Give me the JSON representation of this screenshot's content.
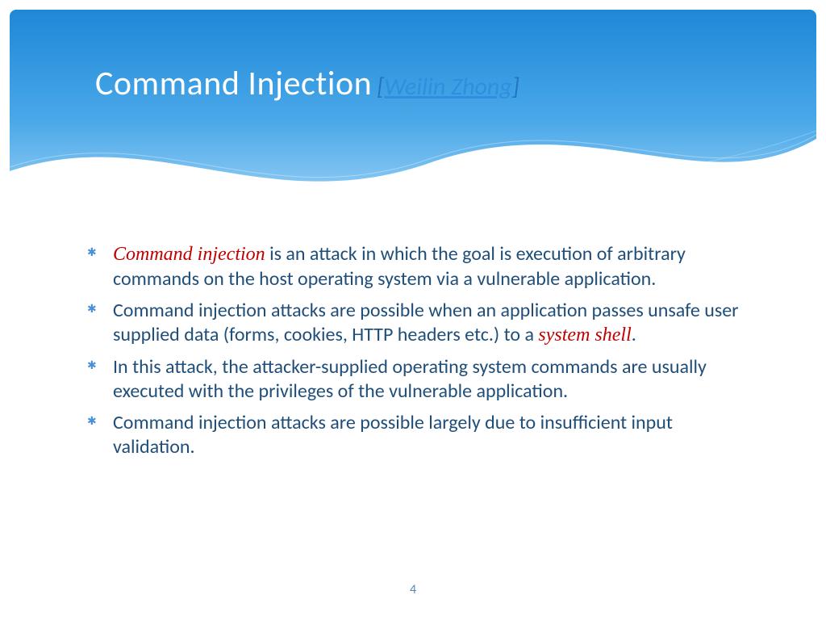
{
  "title": {
    "main": "Command Injection",
    "bracket_open": "[",
    "author_link": "Weilin Zhong",
    "bracket_close": "]"
  },
  "bullets": [
    {
      "lead_em": "Command injection",
      "rest": " is an attack in which the goal is execution of arbitrary commands on the host operating system via a vulnerable application."
    },
    {
      "pre": "Command injection attacks are possible when an application passes unsafe user supplied data (forms, cookies, HTTP headers etc.) to a ",
      "em": "system shell",
      "post": "."
    },
    {
      "text": "In this attack, the attacker-supplied operating system commands are usually executed with the privileges of the vulnerable application."
    },
    {
      "text": "Command injection attacks are possible largely due to insufficient input validation."
    }
  ],
  "page_number": "4"
}
